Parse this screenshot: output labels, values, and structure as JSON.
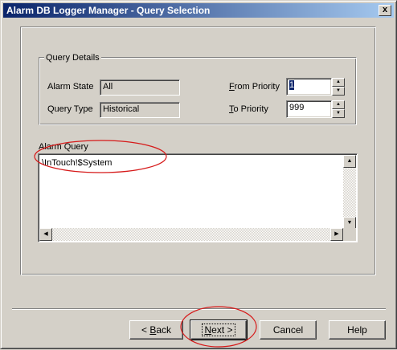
{
  "window": {
    "title": "Alarm DB Logger Manager - Query Selection",
    "close_label": "x"
  },
  "query_details": {
    "group_title": "Query Details",
    "alarm_state_label": "Alarm State",
    "alarm_state_value": "All",
    "query_type_label": "Query Type",
    "query_type_value": "Historical",
    "from_priority_label_first": "F",
    "from_priority_label_rest": "rom Priority",
    "from_priority_value": "1",
    "to_priority_label_first": "T",
    "to_priority_label_rest": "o Priority",
    "to_priority_value": "999"
  },
  "alarm_query": {
    "label": "Alarm Query",
    "value": "\\InTouch!$System"
  },
  "buttons": {
    "back_prefix": "< ",
    "back_mnemonic": "B",
    "back_rest": "ack",
    "next_mnemonic": "N",
    "next_rest": "ext >",
    "cancel": "Cancel",
    "help": "Help"
  },
  "icons": {
    "spin_up": "▲",
    "spin_down": "▼",
    "scroll_up": "▲",
    "scroll_down": "▼",
    "scroll_left": "◀",
    "scroll_right": "▶"
  },
  "colors": {
    "annotation": "#d61a1a",
    "titlebar_start": "#0a246a",
    "titlebar_end": "#a6caf0",
    "face": "#d4d0c8"
  }
}
